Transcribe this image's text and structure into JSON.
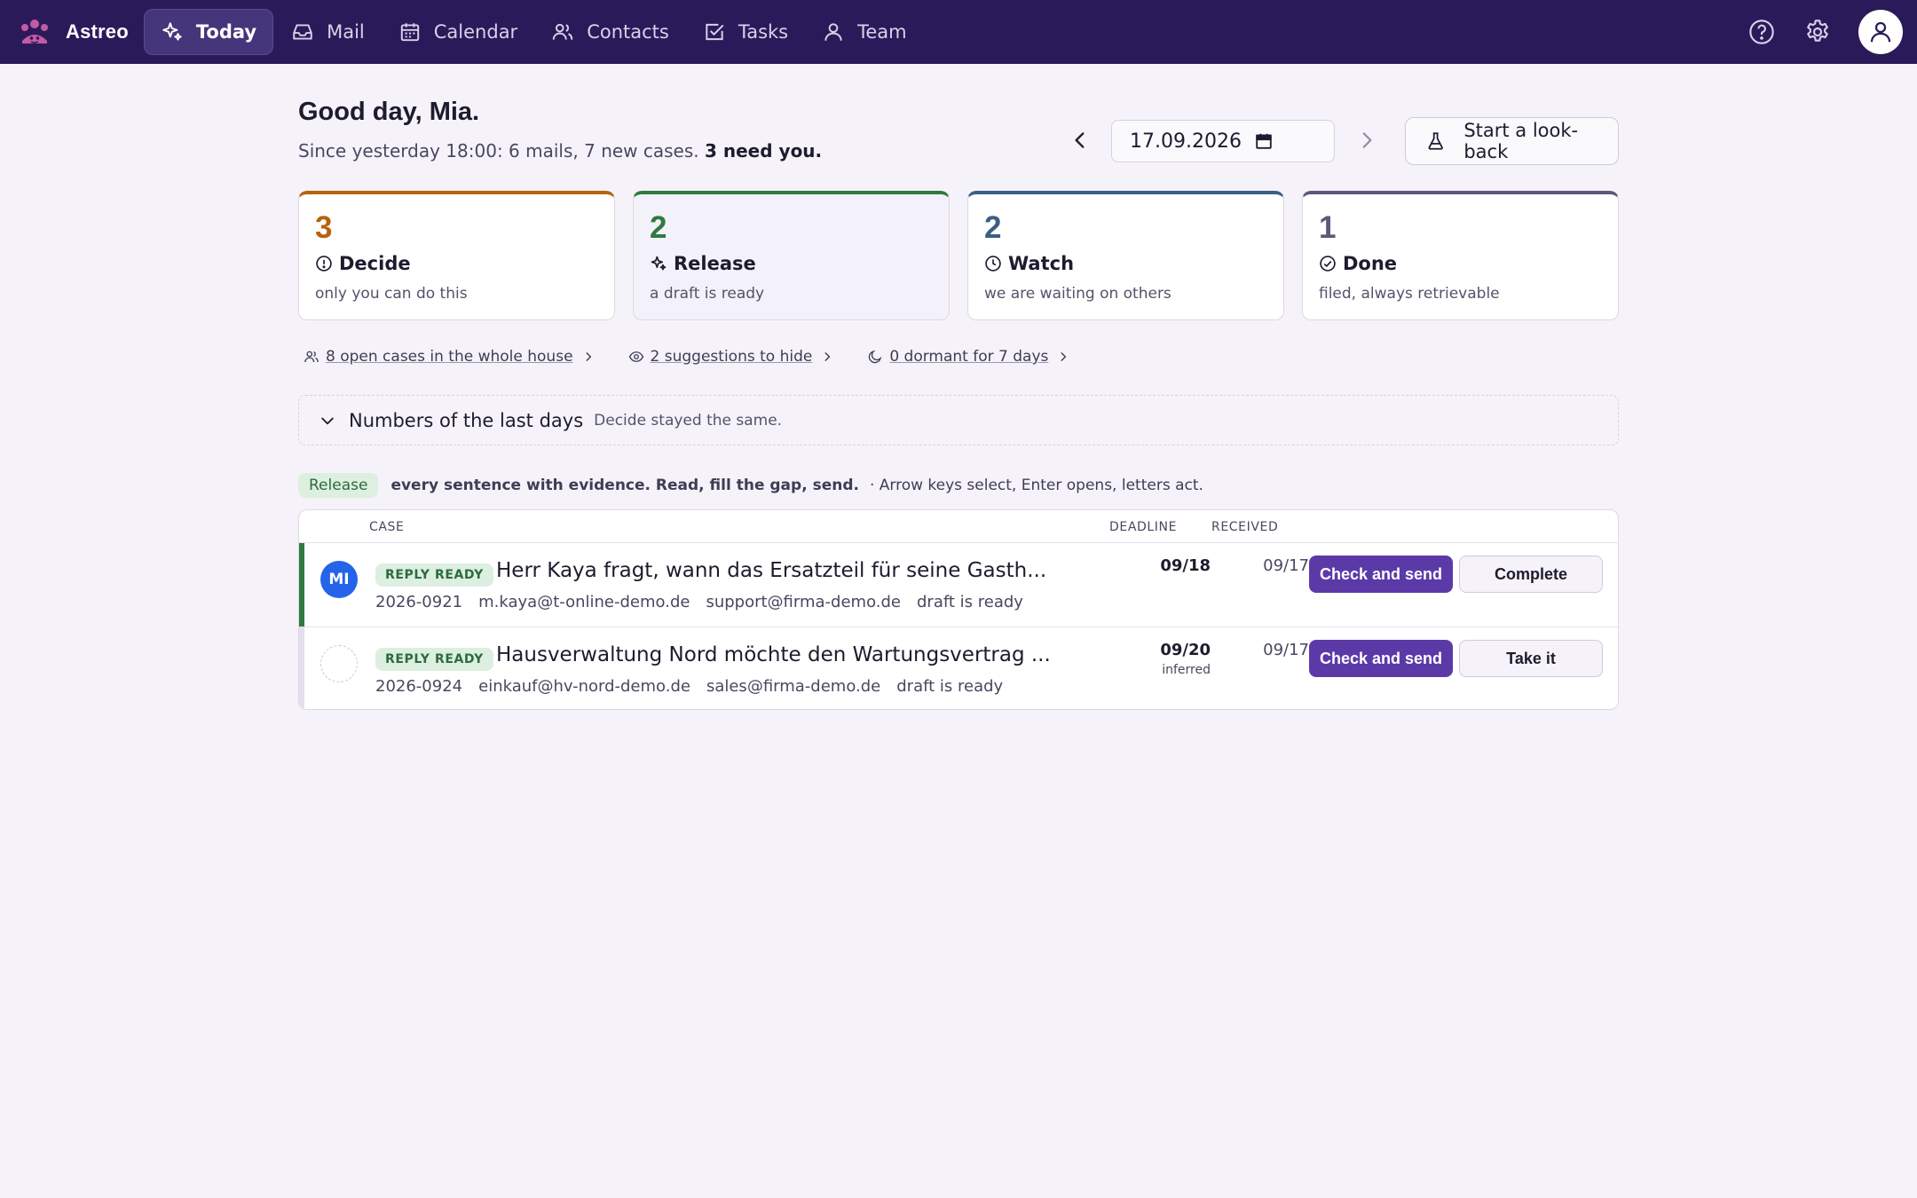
{
  "app": {
    "name": "Astreo"
  },
  "nav": {
    "items": [
      {
        "label": "Today",
        "icon": "sparkle-icon",
        "active": true
      },
      {
        "label": "Mail",
        "icon": "inbox-icon"
      },
      {
        "label": "Calendar",
        "icon": "calendar-icon"
      },
      {
        "label": "Contacts",
        "icon": "contacts-icon"
      },
      {
        "label": "Tasks",
        "icon": "checkbox-icon"
      },
      {
        "label": "Team",
        "icon": "person-icon"
      }
    ]
  },
  "greeting": {
    "title": "Good day, Mia.",
    "summary": "Since yesterday 18:00: 6 mails, 7 new cases.",
    "emphasis": "3 need you."
  },
  "date_picker": {
    "value": "17.09.2026"
  },
  "lookback_button": {
    "label": "Start a look-back"
  },
  "cards": [
    {
      "count": "3",
      "label": "Decide",
      "desc": "only you can do this",
      "color": "#b8620f",
      "icon": "alert-circle-icon"
    },
    {
      "count": "2",
      "label": "Release",
      "desc": "a draft is ready",
      "color": "#2f7a3e",
      "icon": "sparkle-icon",
      "selected": true
    },
    {
      "count": "2",
      "label": "Watch",
      "desc": "we are waiting on others",
      "color": "#3a5f87",
      "icon": "clock-icon"
    },
    {
      "count": "1",
      "label": "Done",
      "desc": "filed, always retrievable",
      "color": "#5c5878",
      "icon": "check-circle-icon"
    }
  ],
  "links": [
    {
      "label": "8 open cases in the whole house",
      "icon": "people-icon"
    },
    {
      "label": "2 suggestions to hide",
      "icon": "eye-icon"
    },
    {
      "label": "0 dormant for 7 days",
      "icon": "moon-icon"
    }
  ],
  "numbers_panel": {
    "title": "Numbers of the last days",
    "summary": "Decide stayed the same."
  },
  "hint": {
    "pill": "Release",
    "text": "every sentence with evidence. Read, fill the gap, send.",
    "keys": "· Arrow keys select, Enter opens, letters act."
  },
  "table": {
    "headers": {
      "case": "CASE",
      "deadline": "DEADLINE",
      "received": "RECEIVED"
    },
    "rows": [
      {
        "avatar": "MI",
        "status": "REPLY READY",
        "title": "Herr Kaya fragt, wann das Ersatzteil für seine Gasth...",
        "id": "2026-0921",
        "from": "m.kaya@t-online-demo.de",
        "to": "support@firma-demo.de",
        "state": "draft is ready",
        "deadline": "09/18",
        "deadline_note": "",
        "received": "09/17",
        "primary_action": "Check and send",
        "secondary_action": "Complete"
      },
      {
        "avatar": "",
        "status": "REPLY READY",
        "title": "Hausverwaltung Nord möchte den Wartungsvertrag ...",
        "id": "2026-0924",
        "from": "einkauf@hv-nord-demo.de",
        "to": "sales@firma-demo.de",
        "state": "draft is ready",
        "deadline": "09/20",
        "deadline_note": "inferred",
        "received": "09/17",
        "primary_action": "Check and send",
        "secondary_action": "Take it"
      }
    ]
  },
  "colors": {
    "topbar": "#2b1a5a",
    "primary": "#5b3aa8",
    "accent_green": "#2f7a3e"
  }
}
